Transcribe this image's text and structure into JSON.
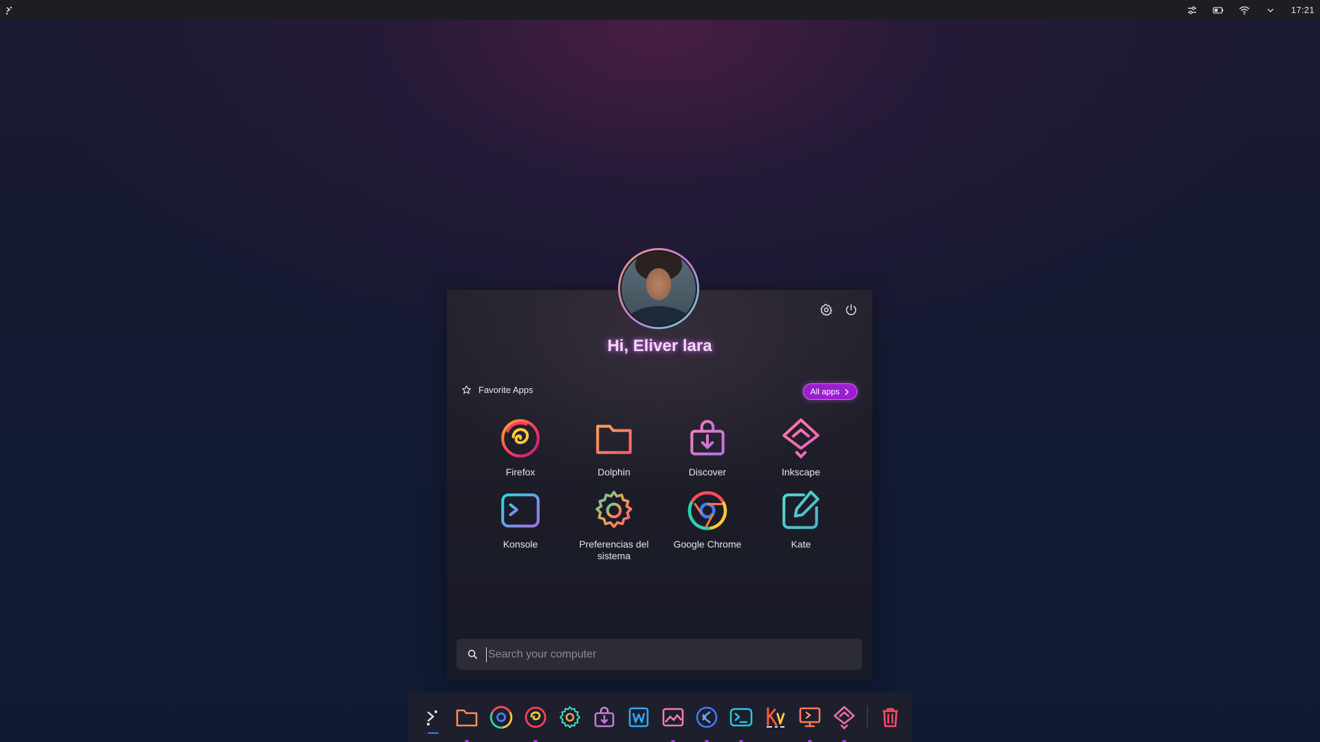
{
  "topbar": {
    "clock": "17:21",
    "icons": [
      "launcher-icon",
      "sliders-icon",
      "battery-icon",
      "wifi-icon",
      "chevron-down-icon"
    ]
  },
  "launcher": {
    "greeting": "Hi, Eliver lara",
    "favorites_title": "Favorite Apps",
    "all_apps_label": "All apps",
    "apps": [
      {
        "label": "Firefox",
        "icon": "firefox-icon"
      },
      {
        "label": "Dolphin",
        "icon": "folder-icon"
      },
      {
        "label": "Discover",
        "icon": "discover-icon"
      },
      {
        "label": "Inkscape",
        "icon": "inkscape-icon"
      },
      {
        "label": "Konsole",
        "icon": "terminal-icon"
      },
      {
        "label": "Preferencias del sistema",
        "icon": "gear-icon"
      },
      {
        "label": "Google Chrome",
        "icon": "chrome-icon"
      },
      {
        "label": "Kate",
        "icon": "kate-icon"
      }
    ],
    "search": {
      "placeholder": "Search your computer",
      "value": ""
    }
  },
  "dock": {
    "items": [
      "launcher-icon",
      "folder-icon",
      "chrome-icon",
      "firefox-icon",
      "gear-icon",
      "discover-icon",
      "writer-icon",
      "image-viewer-icon",
      "vscode-icon",
      "terminal-icon",
      "kvantum-icon",
      "presentation-icon",
      "inkscape-icon",
      "trash-icon"
    ]
  },
  "colors": {
    "accent": "#9a1fcf",
    "greeting_glow": "#b35ad8",
    "panel_bg": "#1b1c27",
    "dock_bg": "#1d1f2c"
  }
}
